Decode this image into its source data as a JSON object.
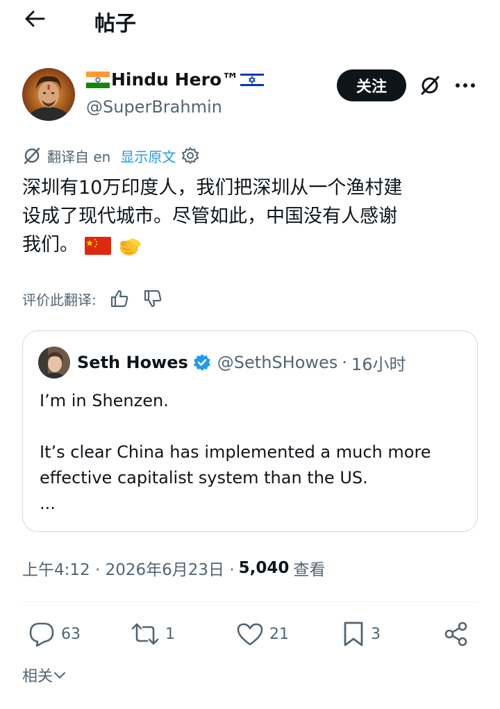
{
  "header": {
    "title": "帖子"
  },
  "author": {
    "name": "Hindu Hero™",
    "handle": "@SuperBrahmin",
    "follow_label": "关注"
  },
  "translation": {
    "translated_from": "翻译自 en",
    "show_original": "显示原文",
    "rate_label": "评价此翻译:"
  },
  "tweet": {
    "lines": [
      "深圳有10万印度人，我们把深圳从一个渔村建",
      "设成了现代城市。尽管如此，中国没有人感谢",
      "我们。"
    ]
  },
  "quote": {
    "name": "Seth Howes",
    "handle": "@SethSHowes",
    "time": "16小时",
    "lines": [
      "I’m in Shenzen.",
      "",
      "It’s clear China has implemented a much more",
      "effective capitalist system than the US.",
      "..."
    ]
  },
  "meta": {
    "timestamp": "上午4:12 · 2026年6月23日 ·",
    "views": "5,040",
    "views_label": "查看"
  },
  "actions": {
    "replies": "63",
    "reposts": "1",
    "likes": "21",
    "bookmarks": "3"
  },
  "footer": {
    "related_label": "相关"
  },
  "colors": {
    "text": "#0f1419",
    "secondary": "#536471",
    "link": "#1d9bf0",
    "border": "#cfd9de"
  },
  "icons": [
    "back-arrow-icon",
    "grok-icon",
    "more-icon",
    "translate-icon",
    "gear-icon",
    "china-flag-emoji",
    "pointing-hand-emoji",
    "thumbs-up-icon",
    "thumbs-down-icon",
    "verified-badge-icon",
    "reply-icon",
    "repost-icon",
    "like-icon",
    "bookmark-icon",
    "share-icon",
    "chevron-down-icon"
  ]
}
